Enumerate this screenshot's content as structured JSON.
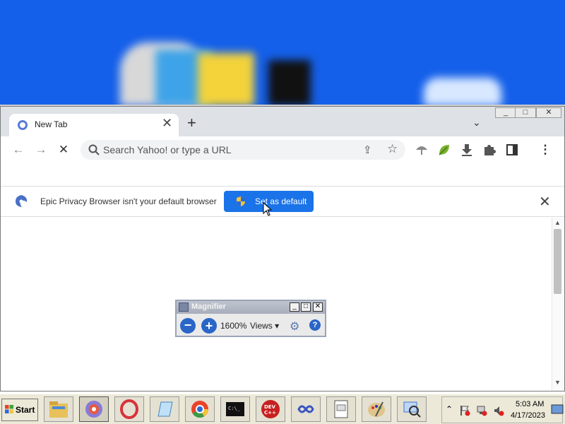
{
  "tab": {
    "title": "New Tab",
    "close_glyph": "✕",
    "new_tab_glyph": "+",
    "search_glyph": "⌄"
  },
  "window_controls": {
    "minimize": "_",
    "maximize": "□",
    "close": "✕"
  },
  "toolbar": {
    "back_glyph": "←",
    "forward_glyph": "→",
    "stop_glyph": "✕",
    "omnibox_placeholder": "Search Yahoo! or type a URL",
    "share_glyph": "⇪",
    "star_glyph": "☆",
    "menu_glyph": "⋮"
  },
  "infobar": {
    "message": "Epic Privacy Browser isn't your default browser",
    "button_label": "Set as default",
    "close_glyph": "✕"
  },
  "magnifier": {
    "title": "Magnifier",
    "zoom_out": "−",
    "zoom_in": "+",
    "zoom_level": "1600%",
    "views_label": "Views ▾",
    "help": "?",
    "gear": "⚙",
    "min": "_",
    "max": "□",
    "close": "✕"
  },
  "taskbar": {
    "start_label": "Start",
    "clock_time": "5:03 AM",
    "clock_date": "4/17/2023",
    "tray_arrow": "⌃",
    "apps": [
      {
        "name": "file-explorer",
        "color": "#e8c15a"
      },
      {
        "name": "epic-browser",
        "color": "#8a7ad6"
      },
      {
        "name": "opera",
        "color": "#d8323b"
      },
      {
        "name": "notepad",
        "color": "#6aa3d8"
      },
      {
        "name": "chrome",
        "color": "#3a9b4a"
      },
      {
        "name": "command-prompt",
        "color": "#111111"
      },
      {
        "name": "dev-cpp",
        "color": "#c82020"
      },
      {
        "name": "infinity-app",
        "color": "#3a54c0"
      },
      {
        "name": "html-file",
        "color": "#dcdcdc"
      },
      {
        "name": "paint",
        "color": "#c9a36a"
      },
      {
        "name": "magnifier",
        "color": "#4a74c9"
      }
    ]
  },
  "colors": {
    "accent": "#1a73e8",
    "magnified_blue": "#1560ea",
    "taskbar": "#ece9d8"
  }
}
